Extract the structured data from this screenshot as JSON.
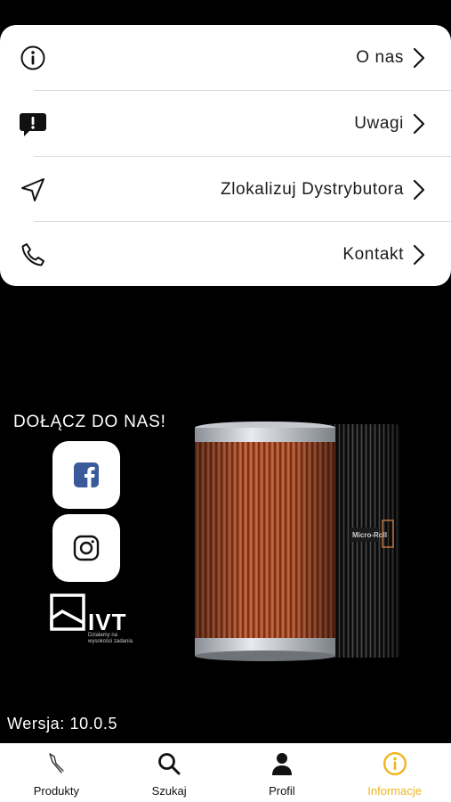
{
  "menu": {
    "items": [
      {
        "label": "O nas",
        "icon": "info-icon"
      },
      {
        "label": "Uwagi",
        "icon": "feedback-bubble-icon"
      },
      {
        "label": "Zlokalizuj Dystrybutora",
        "icon": "location-arrow-icon"
      },
      {
        "label": "Kontakt",
        "icon": "phone-icon"
      }
    ]
  },
  "social": {
    "heading": "DOŁĄCZ DO NAS!",
    "buttons": [
      "facebook-icon",
      "instagram-icon"
    ]
  },
  "brand": {
    "name": "IVT",
    "tagline": "Działamy na wysokości zadania"
  },
  "version_text": "Wersja: 10.0.5",
  "tabbar": {
    "tabs": [
      {
        "label": "Produkty",
        "icon": "pen-tool-icon"
      },
      {
        "label": "Szukaj",
        "icon": "search-icon"
      },
      {
        "label": "Profil",
        "icon": "person-icon"
      },
      {
        "label": "Informacje",
        "icon": "info-icon"
      }
    ],
    "active_tab": "Informacje"
  },
  "colors": {
    "background": "#000000",
    "card": "#ffffff",
    "accent": "#f0b41e",
    "product_orange": "#b3542f"
  }
}
